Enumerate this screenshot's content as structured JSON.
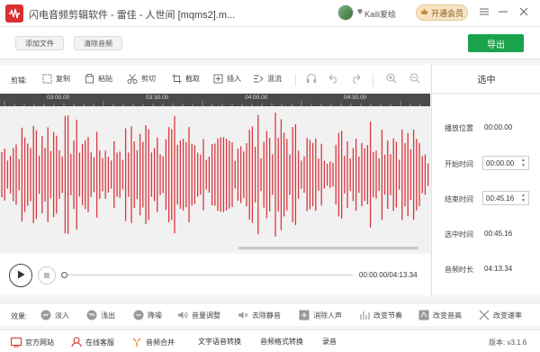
{
  "window": {
    "title": "闪电音频剪辑软件 - 雷佳 - 人世间 [mqms2].m...",
    "user_name": "Kaili爱绘",
    "vip_label": "开通会员"
  },
  "top_actions": {
    "add_file": "添加文件",
    "clear_audio": "清除音频",
    "export": "导出"
  },
  "toolbar": {
    "label": "剪辑:",
    "items": [
      {
        "id": "copy",
        "label": "复制",
        "icon": "copy-icon"
      },
      {
        "id": "paste",
        "label": "粘贴",
        "icon": "paste-icon"
      },
      {
        "id": "cut",
        "label": "剪切",
        "icon": "scissors-icon"
      },
      {
        "id": "crop",
        "label": "截取",
        "icon": "crop-icon"
      },
      {
        "id": "insert",
        "label": "插入",
        "icon": "insert-icon"
      },
      {
        "id": "mix",
        "label": "混流",
        "icon": "mix-icon"
      }
    ],
    "icon_buttons": [
      "headphones-icon",
      "undo-icon",
      "redo-icon",
      "zoom-in-icon",
      "zoom-out-icon"
    ]
  },
  "timeline": {
    "ticks": [
      "03:00.00",
      "03:30.00",
      "04:00.00",
      "04:30.00"
    ]
  },
  "player": {
    "time_current": "00:00.00",
    "time_total": "04:13.34",
    "time_separator": "/",
    "progress": 0
  },
  "selection_panel": {
    "title": "选中",
    "play_position_label": "播放位置",
    "play_position_value": "00:00.00",
    "start_label": "开始时间",
    "start_value": "00:00.00",
    "end_label": "结束时间",
    "end_value": "00:45.16",
    "duration_label": "选中时间",
    "duration_value": "00:45.16",
    "audio_length_label": "音频时长",
    "audio_length_value": "04:13.34"
  },
  "effects": {
    "label": "效果:",
    "items": [
      {
        "id": "fade-in",
        "label": "淡入",
        "icon": "fade-in-icon"
      },
      {
        "id": "fade-out",
        "label": "浅出",
        "icon": "fade-out-icon"
      },
      {
        "id": "denoise",
        "label": "降噪",
        "icon": "denoise-icon"
      },
      {
        "id": "volume",
        "label": "音量调整",
        "icon": "volume-icon"
      },
      {
        "id": "remove-silence",
        "label": "去除静音",
        "icon": "silence-icon"
      },
      {
        "id": "remove-vocals",
        "label": "消除人声",
        "icon": "vocals-icon"
      },
      {
        "id": "tempo",
        "label": "改变节奏",
        "icon": "tempo-icon"
      },
      {
        "id": "pitch",
        "label": "改变音高",
        "icon": "pitch-icon"
      },
      {
        "id": "speed",
        "label": "改变速率",
        "icon": "speed-icon"
      }
    ]
  },
  "footer": {
    "items": [
      {
        "id": "website",
        "label": "官方网站",
        "icon": "website-icon"
      },
      {
        "id": "support",
        "label": "在线客服",
        "icon": "support-icon"
      },
      {
        "id": "merge",
        "label": "音频合并",
        "icon": "merge-icon"
      },
      {
        "id": "tts",
        "label": "文字语音转换",
        "icon": ""
      },
      {
        "id": "format",
        "label": "音频格式转换",
        "icon": ""
      },
      {
        "id": "record",
        "label": "录音",
        "icon": ""
      }
    ],
    "version": "版本: v3.1.6"
  },
  "colors": {
    "accent_green": "#1aa34a",
    "wave_red": "#d9363e",
    "vip_gold": "#f7e4c3"
  }
}
